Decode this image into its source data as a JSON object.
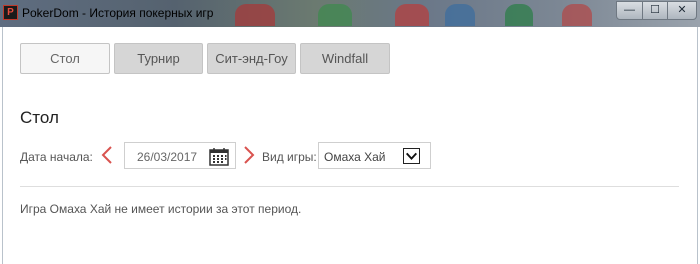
{
  "window": {
    "title": "PokerDom - История покерных игр",
    "app_icon_letter": "P",
    "controls": {
      "minimize": "—",
      "maximize": "☐",
      "close": "✕"
    }
  },
  "tabs": [
    {
      "label": "Стол",
      "active": true
    },
    {
      "label": "Турнир",
      "active": false
    },
    {
      "label": "Сит-энд-Гоу",
      "active": false
    },
    {
      "label": "Windfall",
      "active": false
    }
  ],
  "section": {
    "title": "Стол"
  },
  "filters": {
    "start_date_label": "Дата начала:",
    "start_date_value": "26/03/2017",
    "game_type_label": "Вид игры:",
    "game_type_value": "Омаха Хай"
  },
  "message": "Игра Омаха Хай не имеет истории за этот период.",
  "colors": {
    "accent_arrow": "#d9534f",
    "tab_active_bg": "#f6f6f6",
    "tab_inactive_bg": "#d6d6d6"
  },
  "icons": {
    "prev": "chevron-left-icon",
    "next": "chevron-right-icon",
    "calendar": "calendar-icon",
    "dropdown": "chevron-down-icon"
  }
}
